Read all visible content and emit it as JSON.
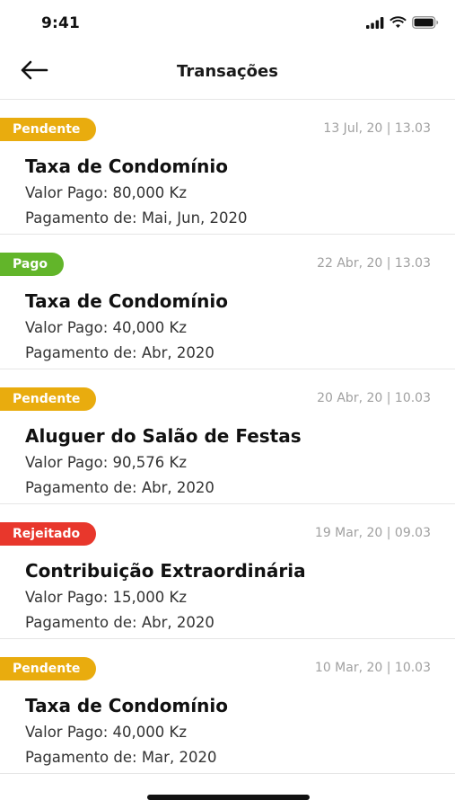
{
  "status_bar": {
    "time": "9:41"
  },
  "header": {
    "title": "Transações",
    "back_icon": "arrow-left-icon"
  },
  "colors": {
    "pendente": "#e9ac0e",
    "pago": "#62b52a",
    "rejeitado": "#e8372c"
  },
  "transactions": [
    {
      "status": "Pendente",
      "status_key": "pendente",
      "date": "13 Jul, 20 | 13.03",
      "title": "Taxa de Condomínio",
      "amount": "Valor Pago: 80,000 Kz",
      "period": "Pagamento de: Mai, Jun, 2020"
    },
    {
      "status": "Pago",
      "status_key": "pago",
      "date": "22 Abr, 20 | 13.03",
      "title": "Taxa de Condomínio",
      "amount": "Valor Pago: 40,000 Kz",
      "period": "Pagamento de: Abr, 2020"
    },
    {
      "status": "Pendente",
      "status_key": "pendente",
      "date": "20 Abr, 20 | 10.03",
      "title": "Aluguer do Salão de Festas",
      "amount": "Valor Pago: 90,576 Kz",
      "period": "Pagamento de: Abr, 2020"
    },
    {
      "status": "Rejeitado",
      "status_key": "rejeitado",
      "date": "19 Mar, 20 | 09.03",
      "title": "Contribuição Extraordinária",
      "amount": "Valor Pago: 15,000 Kz",
      "period": "Pagamento de: Abr, 2020"
    },
    {
      "status": "Pendente",
      "status_key": "pendente",
      "date": "10 Mar, 20 | 10.03",
      "title": "Taxa de Condomínio",
      "amount": "Valor Pago: 40,000 Kz",
      "period": "Pagamento de: Mar, 2020"
    }
  ]
}
